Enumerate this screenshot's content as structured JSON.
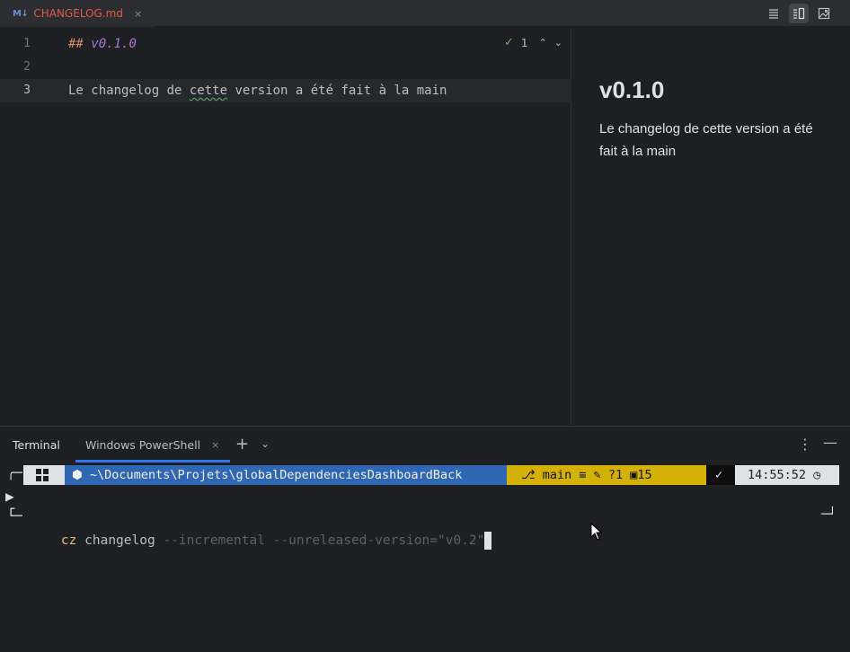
{
  "tab": {
    "icon_text": "M↓",
    "file_name": "CHANGELOG.md",
    "close": "×"
  },
  "toolbar": {
    "icons": [
      "editor-only-icon",
      "split-view-icon",
      "preview-only-icon"
    ]
  },
  "editor": {
    "lines": [
      {
        "number": "1",
        "prefix": "## ",
        "text": "v0.1.0"
      },
      {
        "number": "2",
        "text": ""
      },
      {
        "number": "3",
        "text_a": "Le changelog de ",
        "text_squiggle": "cette",
        "text_b": " version a été fait à la main"
      }
    ],
    "inspection_count": "1"
  },
  "preview": {
    "title": "v0.1.0",
    "text": "Le changelog de cette version a été fait à la main"
  },
  "terminal": {
    "title": "Terminal",
    "tab_label": "Windows PowerShell",
    "tab_close": "×",
    "add": "+",
    "prompt": {
      "path": "~\\Documents\\Projets\\globalDependenciesDashboardBack",
      "branch": "main",
      "git_status": "≡ ✎ ?1",
      "stash": "15",
      "time": "14:55:52"
    },
    "command": {
      "name": "cz",
      "arg": "changelog",
      "flags": "--incremental --unreleased-version=\"v0.2\""
    }
  },
  "colors": {
    "accent": "#3574f0",
    "path_segment": "#2f67b2",
    "git_segment": "#d4b106",
    "modified_file": "#e0584f"
  }
}
